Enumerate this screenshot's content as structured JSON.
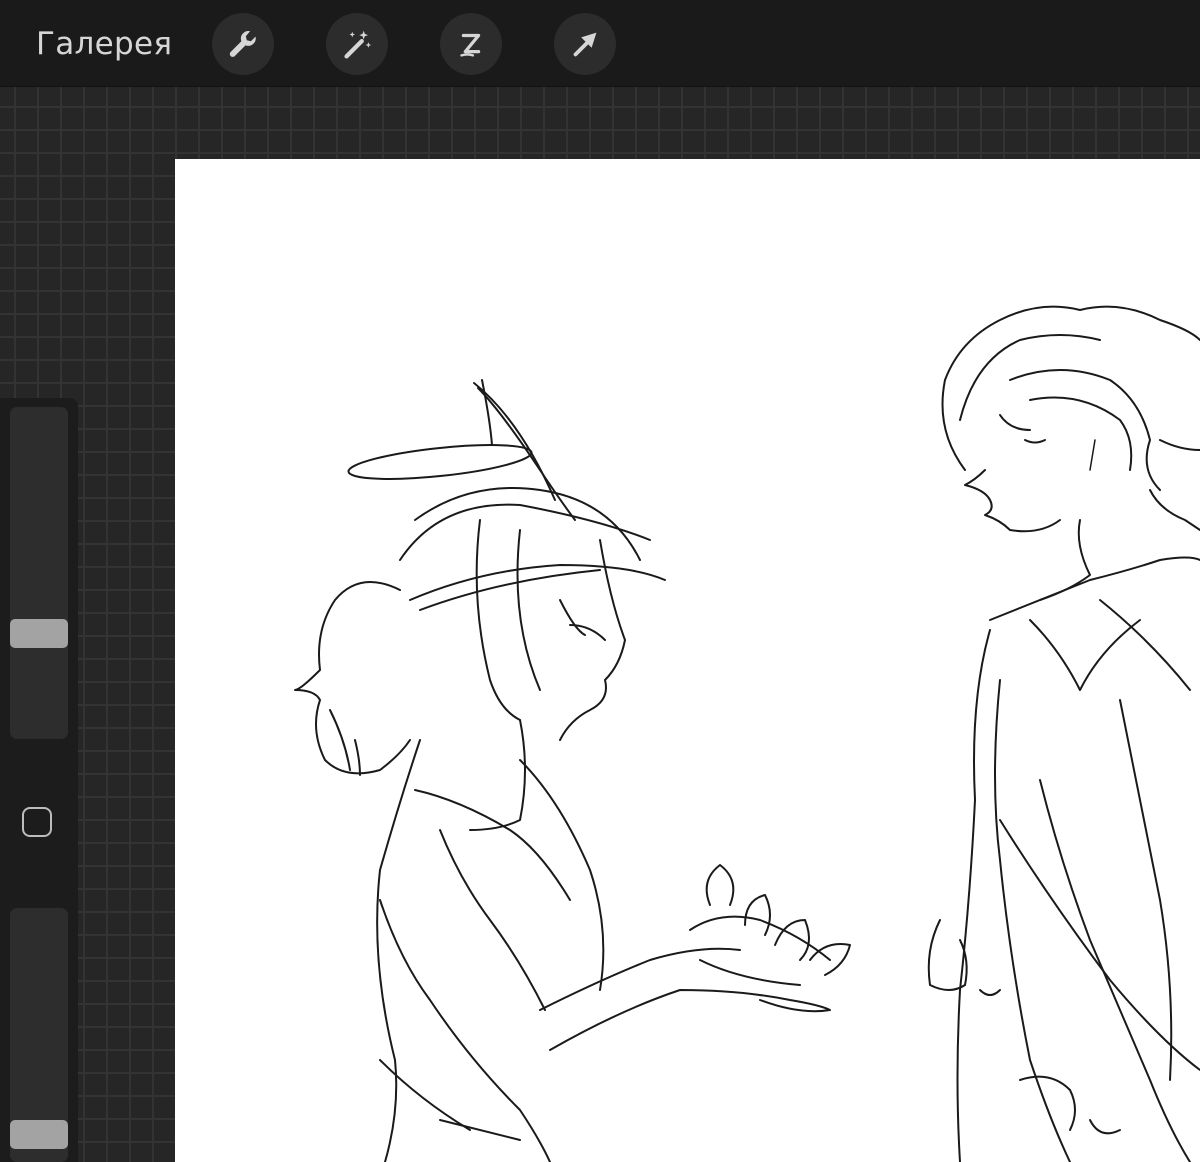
{
  "topbar": {
    "gallery_label": "Галерея",
    "tools": [
      {
        "name": "actions",
        "icon": "wrench-icon"
      },
      {
        "name": "adjustments",
        "icon": "magic-wand-icon"
      },
      {
        "name": "selection",
        "icon": "selection-s-icon"
      },
      {
        "name": "transform",
        "icon": "arrow-cursor-icon"
      }
    ]
  },
  "sidebar": {
    "brush_size_level": 0.3,
    "opacity_level": 0.06
  },
  "colors": {
    "topbar_bg": "#1a1a1a",
    "workspace_bg": "#262626",
    "canvas_bg": "#ffffff",
    "icon_color": "#d6d6d6",
    "slider_thumb": "#a3a3a3"
  }
}
